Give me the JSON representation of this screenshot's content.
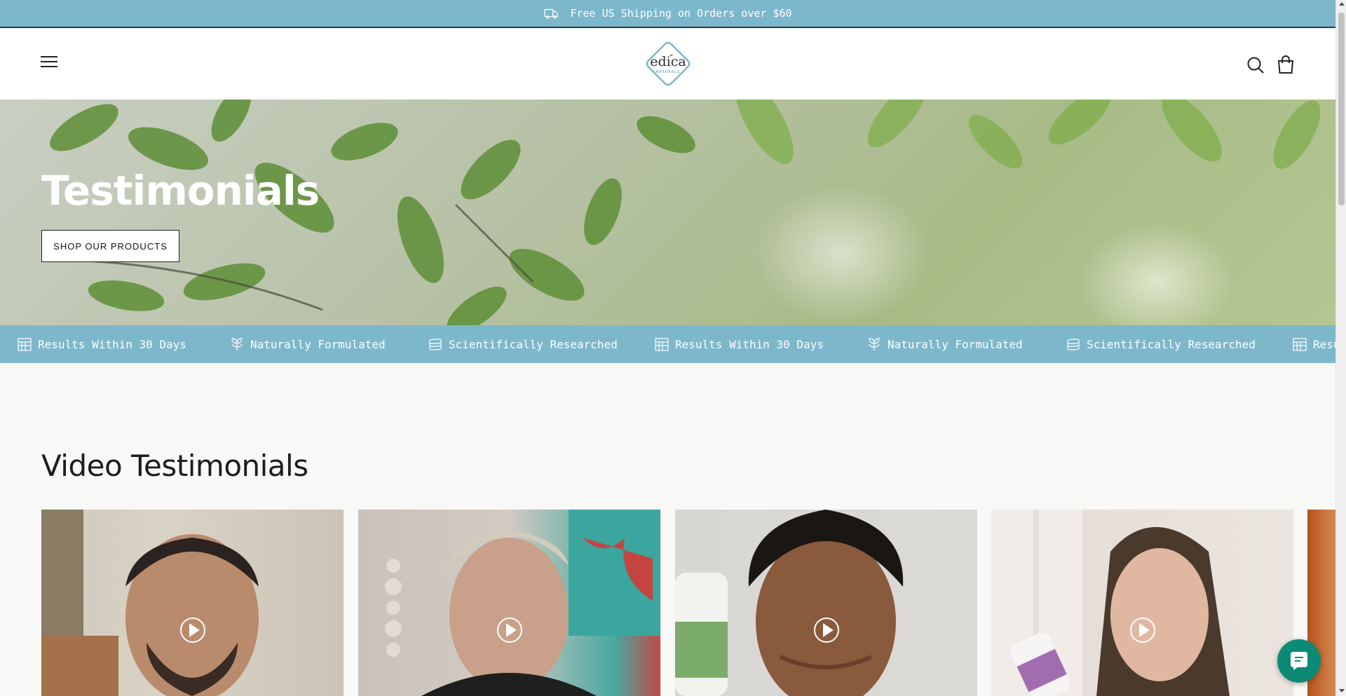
{
  "announcement": {
    "text": "Free US Shipping on Orders over $60",
    "icon": "truck-icon"
  },
  "header": {
    "logo": {
      "brand": "edica",
      "tagline": "NATURALS"
    },
    "icons": [
      "menu-icon",
      "search-icon",
      "cart-icon"
    ]
  },
  "hero": {
    "title": "Testimonials",
    "cta_label": "SHOP OUR PRODUCTS"
  },
  "marquee": {
    "items": [
      {
        "icon": "calendar-icon",
        "label": "Results Within 30 Days"
      },
      {
        "icon": "leaf-icon",
        "label": "Naturally Formulated"
      },
      {
        "icon": "flask-icon",
        "label": "Scientifically Researched"
      },
      {
        "icon": "calendar-icon",
        "label": "Results Within 30 Days"
      },
      {
        "icon": "leaf-icon",
        "label": "Naturally Formulated"
      },
      {
        "icon": "flask-icon",
        "label": "Scientifically Researched"
      },
      {
        "icon": "calendar-icon",
        "label": "Resu"
      }
    ]
  },
  "videos": {
    "title": "Video Testimonials",
    "items": [
      {
        "name": "video-testimonial-1",
        "icon": "play-icon"
      },
      {
        "name": "video-testimonial-2",
        "icon": "play-icon"
      },
      {
        "name": "video-testimonial-3",
        "icon": "play-icon"
      },
      {
        "name": "video-testimonial-4",
        "icon": "play-icon"
      },
      {
        "name": "video-testimonial-5",
        "icon": "play-icon"
      }
    ]
  },
  "colors": {
    "accent": "#7db7cc",
    "chat": "#0d8a75",
    "text_dark": "#1d1d1d",
    "page_bg": "#f8f8f7"
  }
}
